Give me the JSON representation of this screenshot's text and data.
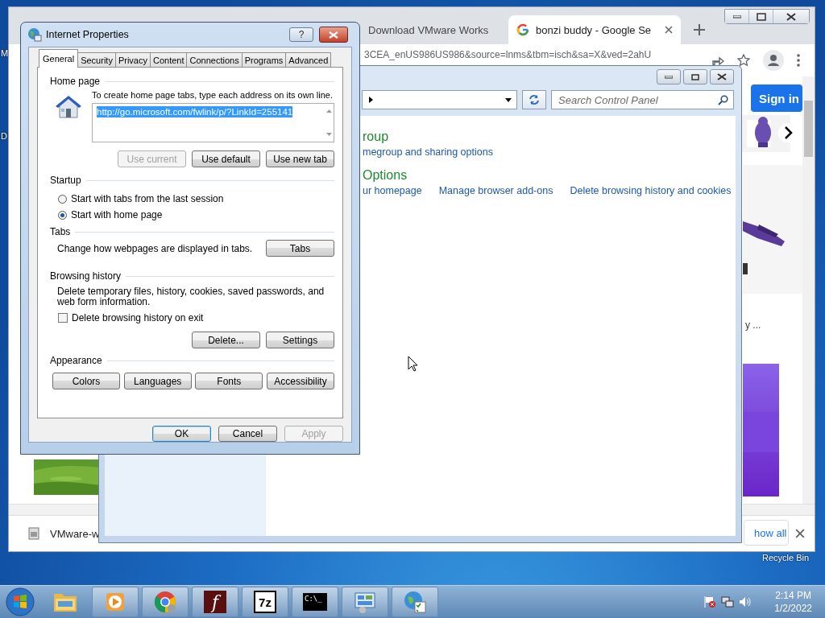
{
  "desktop": {
    "icon_labels": [
      "M",
      "D",
      "Recycle Bin"
    ]
  },
  "browser": {
    "tabs": [
      {
        "title": "Download VMware Works",
        "selected": false
      },
      {
        "title": "bonzi buddy - Google Se",
        "selected": true
      }
    ],
    "address": "3CEA_enUS986US986&source=lnms&tbm=isch&sa=X&ved=2ahU",
    "sign_in": "Sign in",
    "result_caption": "y ...",
    "download": {
      "file": "VMware-w",
      "show_all": "how all"
    }
  },
  "control_panel": {
    "search": {
      "placeholder": "Search Control Panel"
    },
    "sections": [
      {
        "heading": "roup",
        "links": [
          "megroup and sharing options"
        ]
      },
      {
        "heading": "Options",
        "links": [
          "ur homepage",
          "Manage browser add-ons",
          "Delete browsing history and cookies"
        ]
      }
    ]
  },
  "dialog": {
    "title": "Internet Properties",
    "help": "?",
    "tabs": [
      {
        "label": "General",
        "selected": true
      },
      {
        "label": "Security",
        "selected": false
      },
      {
        "label": "Privacy",
        "selected": false
      },
      {
        "label": "Content",
        "selected": false
      },
      {
        "label": "Connections",
        "selected": false
      },
      {
        "label": "Programs",
        "selected": false
      },
      {
        "label": "Advanced",
        "selected": false
      }
    ],
    "home_page": {
      "heading": "Home page",
      "instructions": "To create home page tabs, type each address on its own line.",
      "value": "http://go.microsoft.com/fwlink/p/?LinkId=255141",
      "buttons": [
        {
          "label": "Use current",
          "disabled": true
        },
        {
          "label": "Use default",
          "disabled": false
        },
        {
          "label": "Use new tab",
          "disabled": false
        }
      ]
    },
    "startup": {
      "heading": "Startup",
      "options": [
        {
          "label": "Start with tabs from the last session",
          "selected": false
        },
        {
          "label": "Start with home page",
          "selected": true
        }
      ]
    },
    "tabs_group": {
      "heading": "Tabs",
      "description": "Change how webpages are displayed in tabs.",
      "button": "Tabs"
    },
    "browsing_history": {
      "heading": "Browsing history",
      "description": "Delete temporary files, history, cookies, saved passwords, and web form information.",
      "checkbox": {
        "label": "Delete browsing history on exit",
        "checked": false
      },
      "buttons": [
        "Delete...",
        "Settings"
      ]
    },
    "appearance": {
      "heading": "Appearance",
      "buttons": [
        "Colors",
        "Languages",
        "Fonts",
        "Accessibility"
      ]
    },
    "footer": [
      {
        "label": "OK",
        "default": true,
        "disabled": false
      },
      {
        "label": "Cancel",
        "default": false,
        "disabled": false
      },
      {
        "label": "Apply",
        "default": false,
        "disabled": true
      }
    ]
  },
  "taskbar": {
    "apps": [
      {
        "kind": "explorer"
      },
      {
        "kind": "media"
      },
      {
        "kind": "chrome"
      },
      {
        "kind": "flash",
        "glyph": "f"
      },
      {
        "kind": "archive",
        "glyph": "7z"
      },
      {
        "kind": "console",
        "glyph": "C:\\_"
      },
      {
        "kind": "control-panel"
      },
      {
        "kind": "internet-options"
      }
    ],
    "time": "2:14 PM",
    "date": "1/2/2022"
  }
}
